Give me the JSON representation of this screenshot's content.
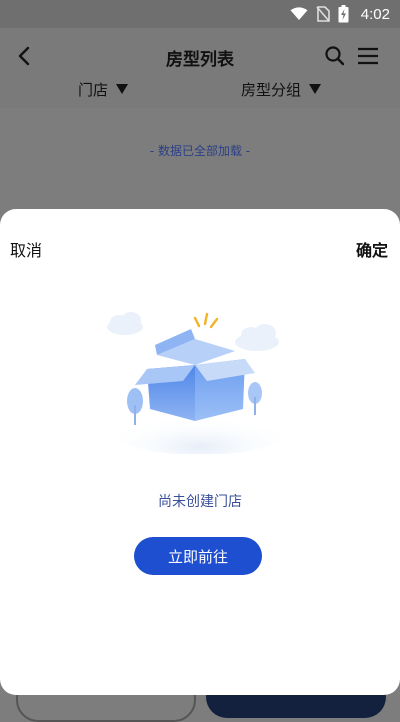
{
  "status_bar": {
    "time": "4:02",
    "icons": [
      "wifi-icon",
      "no-sim-icon",
      "battery-charging-icon"
    ]
  },
  "header": {
    "title": "房型列表",
    "filters": {
      "store": "门店",
      "room_group": "房型分组"
    }
  },
  "list": {
    "end_note": "- 数据已全部加载 -"
  },
  "sheet": {
    "cancel_label": "取消",
    "confirm_label": "确定",
    "empty_message": "尚未创建门店",
    "action_label": "立即前往"
  },
  "colors": {
    "accent": "#1e4fd0",
    "message_text": "#3a4f9a",
    "overlay": "#7d7d7d"
  }
}
